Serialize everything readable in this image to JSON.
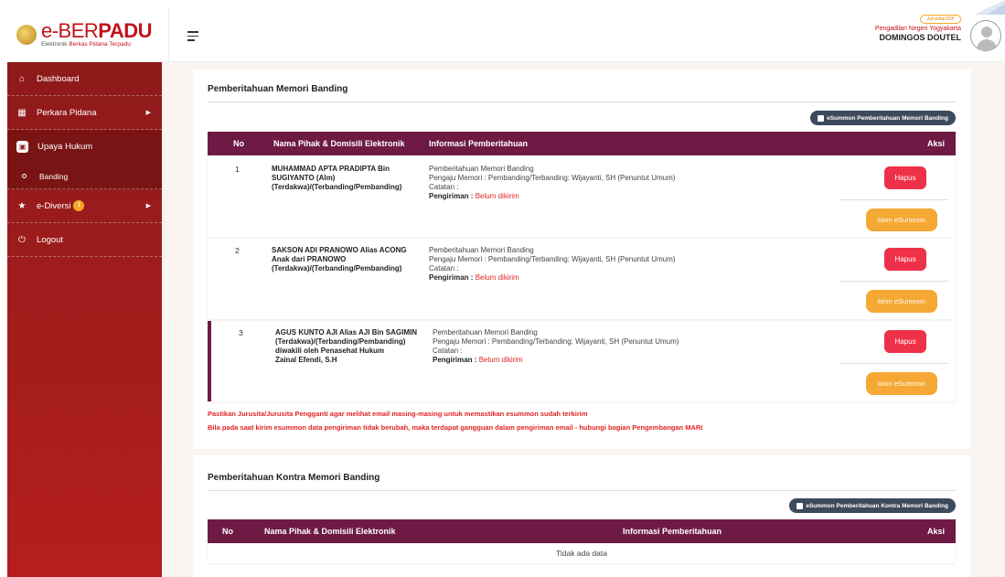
{
  "app": {
    "logo_main": "e-BER",
    "logo_main_bold": "PADU",
    "logo_sub_1": "Elektronik ",
    "logo_sub_2": "Berkas Pidana Terpadu"
  },
  "user": {
    "role": "Jurusita/JSP",
    "court": "Pengadilan Negeri Yogyakarta",
    "name": "DOMINGOS DOUTEL"
  },
  "sidebar": {
    "items": [
      {
        "label": "Dashboard",
        "icon": "home-icon"
      },
      {
        "label": "Perkara Pidana",
        "icon": "folder-icon"
      },
      {
        "label": "Upaya Hukum",
        "icon": "book-icon"
      },
      {
        "label": "Banding",
        "icon": "circle-icon"
      },
      {
        "label": "e-Diversi",
        "icon": "star-icon",
        "badge": "1"
      },
      {
        "label": "Logout",
        "icon": "power-icon"
      }
    ]
  },
  "section1": {
    "title": "Pemberitahuan Memori Banding",
    "esummon_label": "eSummon Pemberitahuan Memori Banding",
    "columns": [
      "No",
      "Nama Pihak & Domisili Elektronik",
      "Informasi Pemberitahuan",
      "Aksi"
    ],
    "rows": [
      {
        "no": "1",
        "party_1": "MUHAMMAD APTA PRADIPTA Bin",
        "party_2": "SUGIYANTO (Alm)",
        "party_3": "(Terdakwa)/(Terbanding/Pembanding)",
        "party_4": "",
        "info_title": "Pemberitahuan Memori Banding",
        "info_pengaju": "Pengaju Memori : Pembanding/Terbanding: Wijayanti, SH (Penuntut Umum)",
        "info_catatan": "Catatan :",
        "pengiriman_label": "Pengiriman :",
        "pengiriman_status": "Belum dikirim"
      },
      {
        "no": "2",
        "party_1": "SAKSON ADI PRANOWO Alias ACONG",
        "party_2": "Anak dari PRANOWO",
        "party_3": "(Terdakwa)/(Terbanding/Pembanding)",
        "party_4": "",
        "info_title": "Pemberitahuan Memori Banding",
        "info_pengaju": "Pengaju Memori : Pembanding/Terbanding: Wijayanti, SH (Penuntut Umum)",
        "info_catatan": "Catatan :",
        "pengiriman_label": "Pengiriman :",
        "pengiriman_status": "Belum dikirim"
      },
      {
        "no": "3",
        "party_1": "AGUS KUNTO AJI Alias AJI Bin SAGIMIN",
        "party_2": "(Terdakwa)/(Terbanding/Pembanding)",
        "party_3": "diwakili oleh Penasehat Hukum",
        "party_4": "Zainal Efendi, S.H",
        "info_title": "Pemberitahuan Memori Banding",
        "info_pengaju": "Pengaju Memori : Pembanding/Terbanding: Wijayanti, SH (Penuntut Umum)",
        "info_catatan": "Catatan :",
        "pengiriman_label": "Pengiriman :",
        "pengiriman_status": "Belum dikirim"
      }
    ],
    "hapus_label": "Hapus",
    "kirim_label": "kirim eSummon",
    "warning_1": "Pastikan Jurusita/Jurusita Pengganti agar melihat email masing-masing untuk memastikan esummon sudah terkirim",
    "warning_2": "Bila pada saat kirim esummon data pengiriman tidak berubah, maka terdapat gangguan dalam pengiriman email - hubungi bagian Pengembangan MARI"
  },
  "section2": {
    "title": "Pemberitahuan Kontra Memori Banding",
    "esummon_label": "eSummon Pemberitahuan Kontra Memori Banding",
    "columns": [
      "No",
      "Nama Pihak & Domisili Elektronik",
      "Informasi Pemberitahuan",
      "Aksi"
    ],
    "empty": "Tidak ada data"
  },
  "colors": {
    "brand_red": "#c0141c",
    "table_header": "#6e1a45",
    "hapus": "#ee3148",
    "kirim": "#f5a833"
  }
}
